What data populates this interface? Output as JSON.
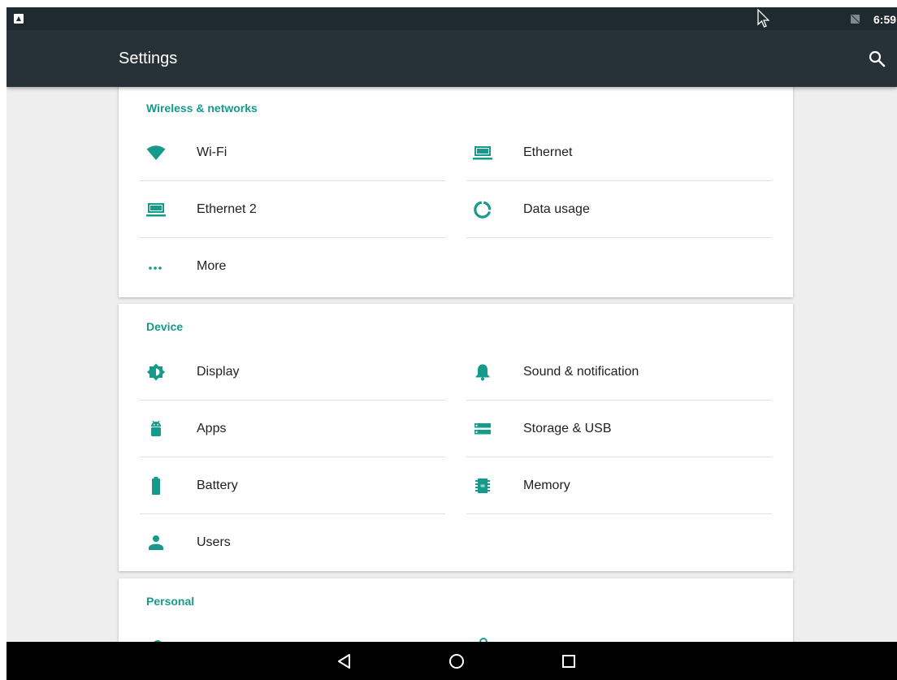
{
  "status_bar": {
    "time": "6:59",
    "icons": [
      "android-notification-icon",
      "mouse-cursor-icon",
      "no-sim-icon"
    ]
  },
  "app_bar": {
    "title": "Settings",
    "search_icon": "search-icon"
  },
  "sections": {
    "wireless": {
      "header": "Wireless & networks",
      "items": [
        {
          "label": "Wi-Fi",
          "icon": "wifi-icon"
        },
        {
          "label": "Ethernet",
          "icon": "ethernet-icon"
        },
        {
          "label": "Ethernet 2",
          "icon": "ethernet-icon"
        },
        {
          "label": "Data usage",
          "icon": "data-usage-icon"
        },
        {
          "label": "More",
          "icon": "more-icon"
        }
      ]
    },
    "device": {
      "header": "Device",
      "items": [
        {
          "label": "Display",
          "icon": "display-brightness-icon"
        },
        {
          "label": "Sound & notification",
          "icon": "bell-icon"
        },
        {
          "label": "Apps",
          "icon": "android-icon"
        },
        {
          "label": "Storage & USB",
          "icon": "storage-icon"
        },
        {
          "label": "Battery",
          "icon": "battery-icon"
        },
        {
          "label": "Memory",
          "icon": "memory-chip-icon"
        },
        {
          "label": "Users",
          "icon": "person-icon"
        }
      ]
    },
    "personal": {
      "header": "Personal"
    }
  },
  "nav_bar": {
    "buttons": [
      "back-icon",
      "home-icon",
      "recents-icon"
    ]
  },
  "colors": {
    "accent": "#159a8c",
    "app_bar": "#263238",
    "status_bar": "#1e2a30",
    "background": "#eeeeee"
  }
}
